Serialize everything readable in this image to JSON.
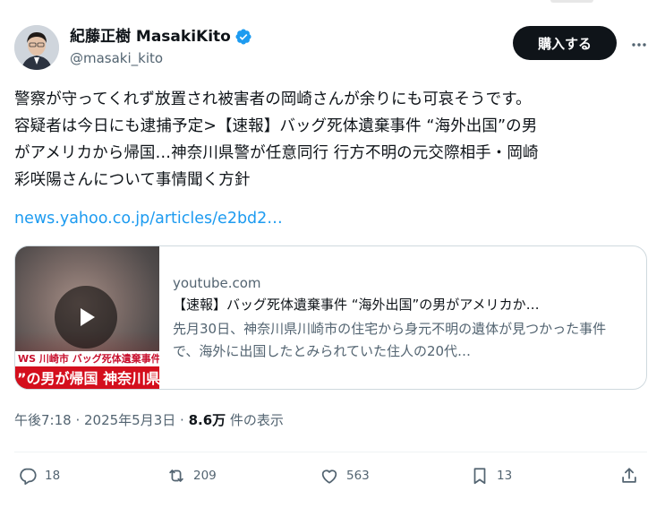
{
  "author": {
    "display_name": "紀藤正樹 MasakiKito",
    "handle": "@masaki_kito",
    "verified": true
  },
  "header": {
    "buy_label": "購入する",
    "more_icon": "more-horizontal-icon"
  },
  "tweet": {
    "text": "警察が守ってくれず放置され被害者の岡崎さんが余りにも可哀そうです。\n容疑者は今日にも逮捕予定>【速報】バッグ死体遺棄事件 “海外出国”の男\nがアメリカから帰国…神奈川県警が任意同行 行方不明の元交際相手・岡崎\n彩咲陽さんについて事情聞く方針",
    "link": "news.yahoo.co.jp/articles/e2bd2…"
  },
  "card": {
    "domain": "youtube.com",
    "title": "【速報】バッグ死体遺棄事件 “海外出国”の男がアメリカか…",
    "description": "先月30日、神奈川県川崎市の住宅から身元不明の遺体が見つかった事件で、海外に出国したとみられていた住人の20代…",
    "thumbnail_caption_top": "WS 川崎市 バッグ死体遺棄事件",
    "thumbnail_caption_main": "”の男が帰国 神奈川県警が"
  },
  "meta": {
    "time": "午後7:18 · 2025年5月3日 · ",
    "views_count": "8.6万",
    "views_label": " 件の表示"
  },
  "actions": {
    "replies": "18",
    "reposts": "209",
    "likes": "563",
    "bookmarks": "13"
  },
  "colors": {
    "accent": "#1d9bf0",
    "text": "#0f1419",
    "secondary": "#536471",
    "verified": "#1d9bf0",
    "button": "#0f1419"
  }
}
